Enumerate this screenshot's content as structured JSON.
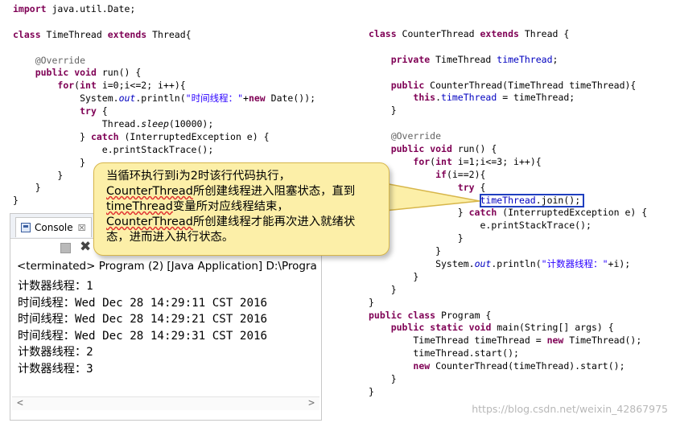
{
  "left_code": [
    {
      "tokens": [
        {
          "t": "import",
          "c": "kw"
        },
        {
          "t": " java.util.Date;"
        }
      ]
    },
    {
      "tokens": []
    },
    {
      "tokens": [
        {
          "t": "class",
          "c": "kw"
        },
        {
          "t": " TimeThread "
        },
        {
          "t": "extends",
          "c": "kw"
        },
        {
          "t": " Thread{"
        }
      ]
    },
    {
      "tokens": []
    },
    {
      "tokens": [
        {
          "t": "    "
        },
        {
          "t": "@Override",
          "c": "ann"
        }
      ]
    },
    {
      "tokens": [
        {
          "t": "    "
        },
        {
          "t": "public",
          "c": "kw"
        },
        {
          "t": " "
        },
        {
          "t": "void",
          "c": "kw"
        },
        {
          "t": " run() {"
        }
      ]
    },
    {
      "tokens": [
        {
          "t": "        "
        },
        {
          "t": "for",
          "c": "kw"
        },
        {
          "t": "("
        },
        {
          "t": "int",
          "c": "kw"
        },
        {
          "t": " i=0;i<=2; i++){"
        }
      ]
    },
    {
      "tokens": [
        {
          "t": "            System."
        },
        {
          "t": "out",
          "c": "stf"
        },
        {
          "t": ".println("
        },
        {
          "t": "\"时间线程：\"",
          "c": "str"
        },
        {
          "t": "+"
        },
        {
          "t": "new",
          "c": "kw"
        },
        {
          "t": " Date());"
        }
      ]
    },
    {
      "tokens": [
        {
          "t": "            "
        },
        {
          "t": "try",
          "c": "kw"
        },
        {
          "t": " {"
        }
      ]
    },
    {
      "tokens": [
        {
          "t": "                Thread."
        },
        {
          "t": "sleep",
          "c": "sta"
        },
        {
          "t": "(10000);"
        }
      ]
    },
    {
      "tokens": [
        {
          "t": "            } "
        },
        {
          "t": "catch",
          "c": "kw"
        },
        {
          "t": " (InterruptedException e) {"
        }
      ]
    },
    {
      "tokens": [
        {
          "t": "                e.printStackTrace();"
        }
      ]
    },
    {
      "tokens": [
        {
          "t": "            }"
        }
      ]
    },
    {
      "tokens": [
        {
          "t": "        }"
        }
      ]
    },
    {
      "tokens": [
        {
          "t": "    }"
        }
      ]
    },
    {
      "tokens": [
        {
          "t": "}"
        }
      ]
    }
  ],
  "right_code": [
    {
      "tokens": [
        {
          "t": "class",
          "c": "kw"
        },
        {
          "t": " CounterThread "
        },
        {
          "t": "extends",
          "c": "kw"
        },
        {
          "t": " Thread {"
        }
      ]
    },
    {
      "tokens": []
    },
    {
      "tokens": [
        {
          "t": "    "
        },
        {
          "t": "private",
          "c": "kw"
        },
        {
          "t": " TimeThread "
        },
        {
          "t": "timeThread",
          "c": "fld"
        },
        {
          "t": ";"
        }
      ]
    },
    {
      "tokens": []
    },
    {
      "tokens": [
        {
          "t": "    "
        },
        {
          "t": "public",
          "c": "kw"
        },
        {
          "t": " CounterThread(TimeThread timeThread){"
        }
      ]
    },
    {
      "tokens": [
        {
          "t": "        "
        },
        {
          "t": "this",
          "c": "kw"
        },
        {
          "t": "."
        },
        {
          "t": "timeThread",
          "c": "fld"
        },
        {
          "t": " = timeThread;"
        }
      ]
    },
    {
      "tokens": [
        {
          "t": "    }"
        }
      ]
    },
    {
      "tokens": []
    },
    {
      "tokens": [
        {
          "t": "    "
        },
        {
          "t": "@Override",
          "c": "ann"
        }
      ]
    },
    {
      "tokens": [
        {
          "t": "    "
        },
        {
          "t": "public",
          "c": "kw"
        },
        {
          "t": " "
        },
        {
          "t": "void",
          "c": "kw"
        },
        {
          "t": " run() {"
        }
      ]
    },
    {
      "tokens": [
        {
          "t": "        "
        },
        {
          "t": "for",
          "c": "kw"
        },
        {
          "t": "("
        },
        {
          "t": "int",
          "c": "kw"
        },
        {
          "t": " i=1;i<=3; i++){"
        }
      ]
    },
    {
      "tokens": [
        {
          "t": "            "
        },
        {
          "t": "if",
          "c": "kw"
        },
        {
          "t": "(i==2){"
        }
      ]
    },
    {
      "tokens": [
        {
          "t": "                "
        },
        {
          "t": "try",
          "c": "kw"
        },
        {
          "t": " {"
        }
      ]
    },
    {
      "tokens": [
        {
          "t": "                    "
        },
        {
          "t": "timeThread",
          "c": "fld"
        },
        {
          "t": ".join();"
        }
      ]
    },
    {
      "tokens": [
        {
          "t": "                } "
        },
        {
          "t": "catch",
          "c": "kw"
        },
        {
          "t": " (InterruptedException e) {"
        }
      ]
    },
    {
      "tokens": [
        {
          "t": "                    e.printStackTrace();"
        }
      ]
    },
    {
      "tokens": [
        {
          "t": "                }"
        }
      ]
    },
    {
      "tokens": [
        {
          "t": "            }"
        }
      ]
    },
    {
      "tokens": [
        {
          "t": "            System."
        },
        {
          "t": "out",
          "c": "stf"
        },
        {
          "t": ".println("
        },
        {
          "t": "\"计数器线程：\"",
          "c": "str"
        },
        {
          "t": "+i);"
        }
      ]
    },
    {
      "tokens": [
        {
          "t": "        }"
        }
      ]
    },
    {
      "tokens": [
        {
          "t": "    }"
        }
      ]
    },
    {
      "tokens": [
        {
          "t": "}"
        }
      ]
    },
    {
      "tokens": [
        {
          "t": "public",
          "c": "kw"
        },
        {
          "t": " "
        },
        {
          "t": "class",
          "c": "kw"
        },
        {
          "t": " Program {"
        }
      ]
    },
    {
      "tokens": [
        {
          "t": "    "
        },
        {
          "t": "public",
          "c": "kw"
        },
        {
          "t": " "
        },
        {
          "t": "static",
          "c": "kw"
        },
        {
          "t": " "
        },
        {
          "t": "void",
          "c": "kw"
        },
        {
          "t": " main(String[] args) {"
        }
      ]
    },
    {
      "tokens": [
        {
          "t": "        TimeThread timeThread = "
        },
        {
          "t": "new",
          "c": "kw"
        },
        {
          "t": " TimeThread();"
        }
      ]
    },
    {
      "tokens": [
        {
          "t": "        timeThread.start();"
        }
      ]
    },
    {
      "tokens": [
        {
          "t": "        "
        },
        {
          "t": "new",
          "c": "kw"
        },
        {
          "t": " CounterThread(timeThread).start();"
        }
      ]
    },
    {
      "tokens": [
        {
          "t": "    }"
        }
      ]
    },
    {
      "tokens": [
        {
          "t": "}"
        }
      ]
    }
  ],
  "console": {
    "tab_label": "Console",
    "close_glyph": "☒",
    "remove_glyph": "✖",
    "header": "<terminated> Program (2) [Java Application] D:\\Progra",
    "lines": [
      "计数器线程：1",
      "时间线程：Wed Dec 28 14:29:11 CST 2016",
      "时间线程：Wed Dec 28 14:29:21 CST 2016",
      "时间线程：Wed Dec 28 14:29:31 CST 2016",
      "计数器线程：2",
      "计数器线程：3"
    ],
    "scroll_left": "<",
    "scroll_right": ">"
  },
  "callout": {
    "text": "当循环执行到i为2时该行代码执行，\nCounterThread所创建线程进入阻塞状态，直到\ntimeThread变量所对应线程结束，\nCounterThread所创建线程才能再次进入就绪状\n态，进而进入执行状态。"
  },
  "watermark": "https://blog.csdn.net/weixin_42867975",
  "colors": {
    "keyword": "#7f0055",
    "field": "#0000c0",
    "string": "#2a00ff",
    "annotation": "#646464",
    "callout_bg": "#fcefa8",
    "highlight_box": "#1f3fbf"
  }
}
